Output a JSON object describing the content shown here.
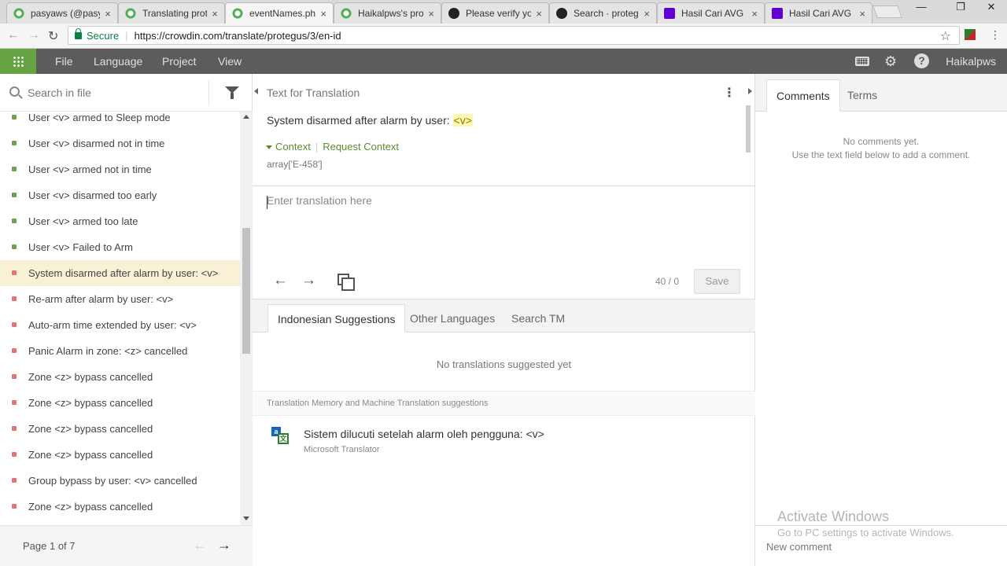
{
  "browser": {
    "tabs": [
      {
        "label": "pasyaws (@pasy",
        "icon": "crowdin-icon",
        "active": false
      },
      {
        "label": "Translating prot",
        "icon": "crowdin-icon",
        "active": false
      },
      {
        "label": "eventNames.php",
        "icon": "crowdin-icon",
        "active": true
      },
      {
        "label": "Haikalpws's pro",
        "icon": "crowdin-icon",
        "active": false
      },
      {
        "label": "Please verify yo",
        "icon": "github-icon",
        "active": false
      },
      {
        "label": "Search · protegu",
        "icon": "github-icon",
        "active": false
      },
      {
        "label": "Hasil Cari AVG",
        "icon": "yahoo-icon",
        "active": false
      },
      {
        "label": "Hasil Cari AVG",
        "icon": "yahoo-icon",
        "active": false
      }
    ],
    "tab_close": "×",
    "secure_label": "Secure",
    "url": "https://crowdin.com/translate/protegus/3/en-id"
  },
  "appbar": {
    "menu": [
      "File",
      "Language",
      "Project",
      "View"
    ],
    "username": "Haikalpws"
  },
  "left": {
    "search_placeholder": "Search in file",
    "strings": [
      {
        "text": "User <v> armed to Sleep mode",
        "status": "green"
      },
      {
        "text": "User <v> disarmed not in time",
        "status": "green"
      },
      {
        "text": "User <v> armed not in time",
        "status": "green"
      },
      {
        "text": "User <v> disarmed too early",
        "status": "green"
      },
      {
        "text": "User <v> armed too late",
        "status": "green"
      },
      {
        "text": "User <v> Failed to Arm",
        "status": "green"
      },
      {
        "text": "System disarmed after alarm by user: <v>",
        "status": "red",
        "active": true
      },
      {
        "text": "Re-arm after alarm by user: <v>",
        "status": "red"
      },
      {
        "text": "Auto-arm time extended by user: <v>",
        "status": "red"
      },
      {
        "text": "Panic Alarm in zone: <z> cancelled",
        "status": "red"
      },
      {
        "text": "Zone <z> bypass cancelled",
        "status": "red"
      },
      {
        "text": "Zone <z> bypass cancelled",
        "status": "red"
      },
      {
        "text": "Zone <z> bypass cancelled",
        "status": "red"
      },
      {
        "text": "Zone <z> bypass cancelled",
        "status": "red"
      },
      {
        "text": "Group bypass by user: <v> cancelled",
        "status": "red"
      },
      {
        "text": "Zone <z> bypass cancelled",
        "status": "red"
      }
    ],
    "pager": "Page 1 of 7"
  },
  "middle": {
    "header": "Text for Translation",
    "source_prefix": "System disarmed after alarm by user: ",
    "source_var": "<v>",
    "context_label": "Context",
    "context_sep": "|",
    "request_context": "Request Context",
    "context_value": "array['E-458']",
    "translation_placeholder": "Enter translation here",
    "counter": "40 / 0",
    "save_label": "Save",
    "sug_tabs": [
      "Indonesian Suggestions",
      "Other Languages",
      "Search TM"
    ],
    "no_suggestions": "No translations suggested yet",
    "tm_header": "Translation Memory and Machine Translation suggestions",
    "mt_text": "Sistem dilucuti setelah alarm oleh pengguna: <v>",
    "mt_source": "Microsoft Translator"
  },
  "right": {
    "tabs": [
      "Comments",
      "Terms"
    ],
    "no_comments": "No comments yet.",
    "no_comments_hint": "Use the text field below to add a comment.",
    "new_comment_placeholder": "New comment"
  },
  "watermark": {
    "title": "Activate Windows",
    "subtitle": "Go to PC settings to activate Windows."
  },
  "colors": {
    "accent_green": "#66a342",
    "appbar_bg": "#5c5c5c",
    "active_row": "#f8f1d6",
    "status_red": "#e57373",
    "status_green": "#6fa34a"
  }
}
